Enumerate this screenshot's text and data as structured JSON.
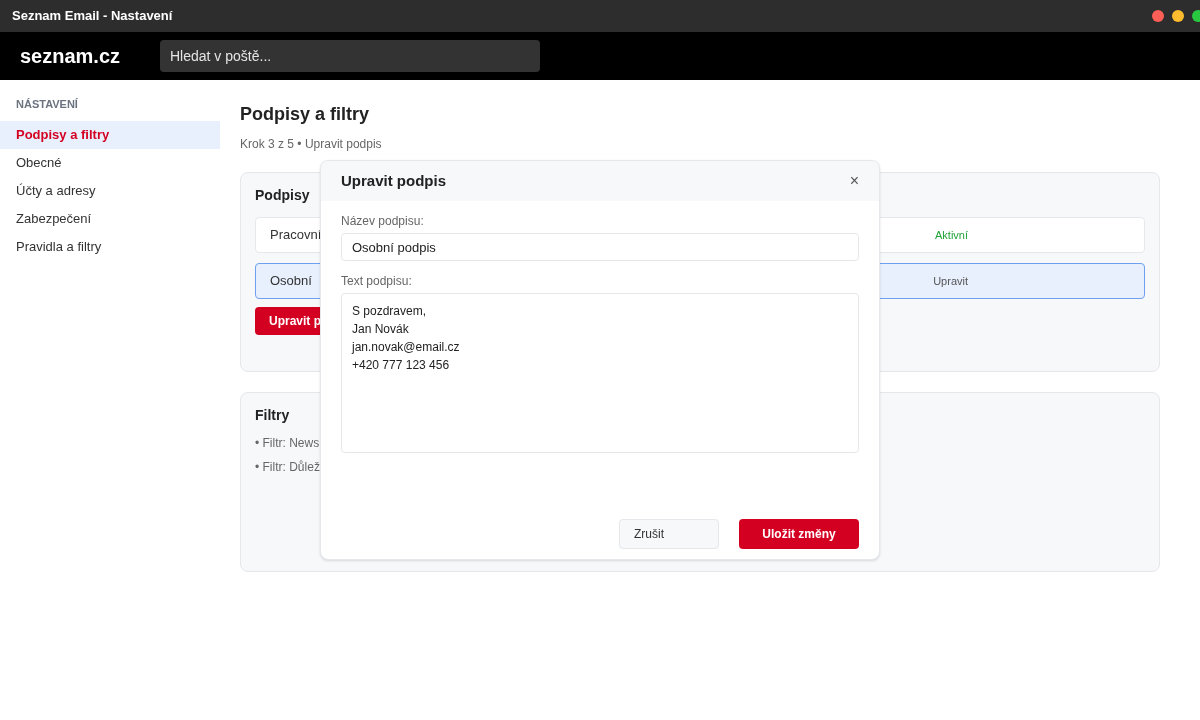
{
  "window": {
    "title": "Seznam Email - Nastavení"
  },
  "header": {
    "logo": "seznam.cz",
    "search": {
      "placeholder": "Hledat v poště..."
    }
  },
  "sidebar": {
    "heading": "NÁSTAVENÍ",
    "items": [
      {
        "label": "Podpisy a filtry",
        "selected": true
      },
      {
        "label": "Obecné",
        "selected": false
      },
      {
        "label": "Účty a adresy",
        "selected": false
      },
      {
        "label": "Zabezpečení",
        "selected": false
      },
      {
        "label": "Pravidla a filtry",
        "selected": false
      }
    ]
  },
  "page": {
    "title": "Podpisy a filtry",
    "subtitle": "Krok 3 z 5 • Upravit podpis"
  },
  "signatures": {
    "title": "Podpisy",
    "rows": [
      {
        "name": "Pracovní",
        "status": "Aktivní",
        "kind": "active",
        "selected": false
      },
      {
        "name": "Osobní",
        "status": "Upravit",
        "kind": "edit",
        "selected": true
      }
    ],
    "button": "Upravit p"
  },
  "filters": {
    "title": "Filtry",
    "items": [
      "• Filtr: News",
      "• Filtr: Důlež"
    ]
  },
  "dialog": {
    "title": "Upravit podpis",
    "close": "×",
    "name_label": "Název podpisu:",
    "name_value": "Osobní podpis",
    "text_label": "Text podpisu:",
    "text_value": "S pozdravem,\nJan Novák\njan.novak@email.cz\n+420 777 123 456",
    "cancel": "Zrušit",
    "save": "Uložit změny"
  }
}
